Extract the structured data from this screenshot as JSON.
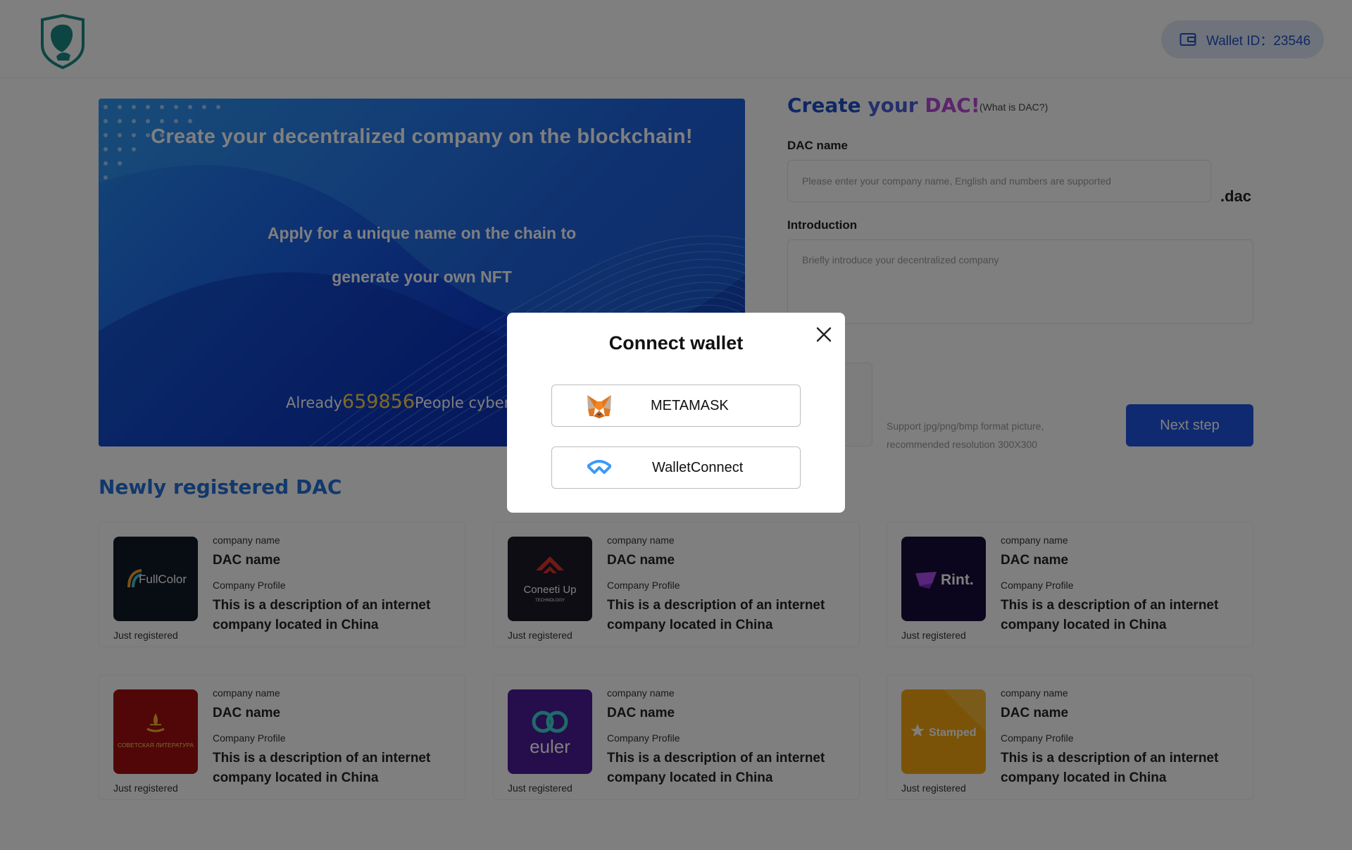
{
  "header": {
    "wallet_label": "Wallet ID：23546"
  },
  "banner": {
    "title": "Create your decentralized company on the blockchain!",
    "subtitle_line1": "Apply for a unique name on the chain to",
    "subtitle_line2": "generate your own NFT",
    "count_prefix": "Already",
    "count_value": "659856",
    "count_suffix": "People cybersq"
  },
  "form": {
    "title_part1": "Create ",
    "title_part2": "your ",
    "title_part3": "DAC!",
    "what_is_dac": "(What is DAC?)",
    "dac_name_label": "DAC name",
    "dac_name_placeholder": "Please enter your company name, English and numbers are supported",
    "dac_suffix": ".dac",
    "intro_label": "Introduction",
    "intro_placeholder": "Briefly introduce your decentralized company",
    "hint_line1": "Support jpg/png/bmp format picture,",
    "hint_line2": "recommended resolution 300X300",
    "next_button": "Next step"
  },
  "section": {
    "title": "Newly registered DAC"
  },
  "cards": [
    {
      "logo_text": "FullColor",
      "logo_bg": "#111826",
      "company_label": "company name",
      "dac_name": "DAC name",
      "profile_label": "Company Profile",
      "description": "This is a description of an internet company located in China",
      "status": "Just registered"
    },
    {
      "logo_text": "Coneeti Up",
      "logo_sub": "TECHNOLOGY",
      "logo_bg": "#1a1a26",
      "company_label": "company name",
      "dac_name": "DAC name",
      "profile_label": "Company Profile",
      "description": "This is a description of an internet company located in China",
      "status": "Just registered"
    },
    {
      "logo_text": "Rint.",
      "logo_bg": "#170d3a",
      "company_label": "company name",
      "dac_name": "DAC name",
      "profile_label": "Company Profile",
      "description": "This is a description of an internet company located in China",
      "status": "Just registered"
    },
    {
      "logo_text": "СОВЕТСКАЯ ЛИТЕРАТУРА",
      "logo_bg": "#a30f0f",
      "company_label": "company name",
      "dac_name": "DAC name",
      "profile_label": "Company Profile",
      "description": "This is a description of an internet company located in China",
      "status": "Just registered"
    },
    {
      "logo_text": "euler",
      "logo_bg": "#4a1d96",
      "company_label": "company name",
      "dac_name": "DAC name",
      "profile_label": "Company Profile",
      "description": "This is a description of an internet company located in China",
      "status": "Just registered"
    },
    {
      "logo_text": "Stamped",
      "logo_bg": "#f5a613",
      "company_label": "company name",
      "dac_name": "DAC name",
      "profile_label": "Company Profile",
      "description": "This is a description of an internet company located in China",
      "status": "Just registered"
    }
  ],
  "modal": {
    "title": "Connect wallet",
    "options": [
      {
        "label": "METAMASK",
        "icon": "metamask-fox-icon"
      },
      {
        "label": "WalletConnect",
        "icon": "walletconnect-icon"
      }
    ]
  },
  "colors": {
    "primary": "#1e55e3",
    "banner_blue": "#0f3fd2",
    "count_gold": "#ffd54a",
    "section_title": "#2471d9"
  }
}
